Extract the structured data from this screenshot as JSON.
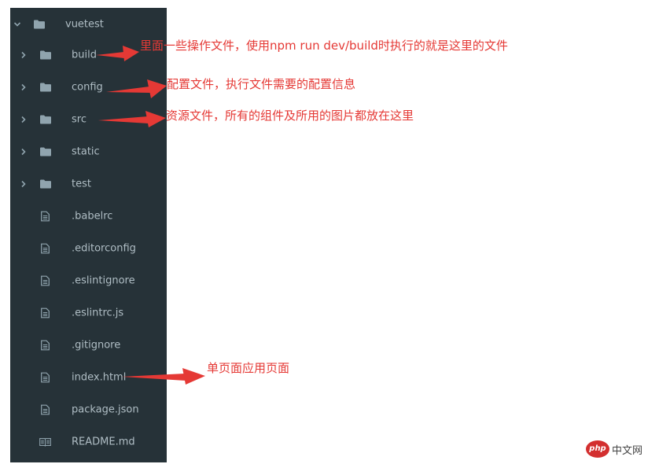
{
  "explorer": {
    "root": {
      "name": "vuetest"
    },
    "items": [
      {
        "name": "build",
        "kind": "folder"
      },
      {
        "name": "config",
        "kind": "folder"
      },
      {
        "name": "src",
        "kind": "folder"
      },
      {
        "name": "static",
        "kind": "folder"
      },
      {
        "name": "test",
        "kind": "folder"
      },
      {
        "name": ".babelrc",
        "kind": "file"
      },
      {
        "name": ".editorconfig",
        "kind": "file"
      },
      {
        "name": ".eslintignore",
        "kind": "file"
      },
      {
        "name": ".eslintrc.js",
        "kind": "file"
      },
      {
        "name": ".gitignore",
        "kind": "file"
      },
      {
        "name": "index.html",
        "kind": "file"
      },
      {
        "name": "package.json",
        "kind": "file"
      },
      {
        "name": "README.md",
        "kind": "book"
      }
    ]
  },
  "annotations": {
    "build": "里面一些操作文件，使用npm run dev/build时执行的就是这里的文件",
    "config": "配置文件，执行文件需要的配置信息",
    "src": "资源文件，所有的组件及所用的图片都放在这里",
    "index": "单页面应用页面"
  },
  "colors": {
    "sidebar_bg": "#263238",
    "item_text": "#b0bec5",
    "icon": "#90a4ae",
    "annotation": "#e53935"
  },
  "watermark": {
    "logo": "php",
    "text": "中文网"
  }
}
